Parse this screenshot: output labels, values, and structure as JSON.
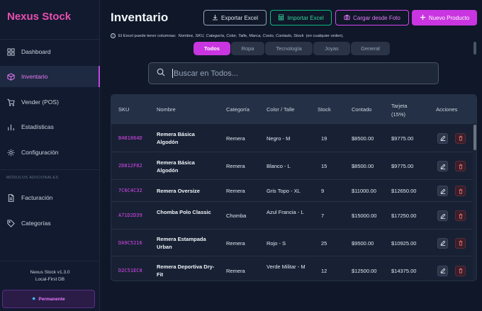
{
  "app": {
    "brand": "Nexus Stock",
    "version": "Nexus Stock v1.3.0",
    "db": "Local-First DB",
    "license": "Permanente"
  },
  "sidebar": {
    "items": [
      {
        "label": "Dashboard",
        "icon": "grid-icon"
      },
      {
        "label": "Inventario",
        "icon": "box-icon"
      },
      {
        "label": "Vender (POS)",
        "icon": "cart-icon"
      },
      {
        "label": "Estadísticas",
        "icon": "bar-chart-icon"
      },
      {
        "label": "Configuración",
        "icon": "gear-icon"
      }
    ],
    "section_label": "MÓDULOS ADICIONALES",
    "extra_items": [
      {
        "label": "Facturación",
        "icon": "document-icon"
      },
      {
        "label": "Categorías",
        "icon": "tag-icon"
      }
    ]
  },
  "header": {
    "title": "Inventario",
    "buttons": {
      "export": "Exportar Excel",
      "import": "Importar Excel",
      "photo": "Cargar desde Foto",
      "new": "Nuevo Producto"
    },
    "hint_prefix": "El Excel puede tener columnas:",
    "hint_columns": "Nombre, SKU, Categoría, Color, Talle, Marca, Costo, Contado, Stock",
    "hint_suffix": "(en cualquier orden)."
  },
  "tabs": [
    "Todos",
    "Ropa",
    "Tecnología",
    "Joyas",
    "General"
  ],
  "active_tab": "Todos",
  "search": {
    "placeholder": "Buscar en Todos...",
    "value": ""
  },
  "table": {
    "headers": [
      "SKU",
      "Nombre",
      "Categoría",
      "Color / Talle",
      "Stock",
      "Contado",
      "Tarjeta\n(15%)",
      "Acciones"
    ],
    "rows": [
      {
        "sku": "B481864D",
        "name": "Remera Básica Algodón",
        "category": "Remera",
        "color": "Negro - M",
        "stock": "19",
        "cash": "$8500.00",
        "card": "$9775.00"
      },
      {
        "sku": "2D812F82",
        "name": "Remera Básica Algodón",
        "category": "Remera",
        "color": "Blanco - L",
        "stock": "15",
        "cash": "$8500.00",
        "card": "$9775.00"
      },
      {
        "sku": "7C6C4C32",
        "name": "Remera Oversize",
        "category": "Remera",
        "color": "Gris Topo - XL",
        "stock": "9",
        "cash": "$11000.00",
        "card": "$12650.00"
      },
      {
        "sku": "A71D2D39",
        "name": "Chomba Polo Classic",
        "category": "Chomba",
        "color": "Azul Francia - L",
        "stock": "7",
        "cash": "$15000.00",
        "card": "$17250.00"
      },
      {
        "sku": "DA9C5216",
        "name": "Remera Estampada Urban",
        "category": "Remera",
        "color": "Rojo - S",
        "stock": "25",
        "cash": "$9500.00",
        "card": "$10925.00"
      },
      {
        "sku": "D2C51EC8",
        "name": "Remera Deportiva Dry-Fit",
        "category": "Remera",
        "color": "Verde Militar - M",
        "stock": "12",
        "cash": "$12500.00",
        "card": "$14375.00"
      }
    ]
  },
  "colors": {
    "accent": "#c935e0",
    "sku": "#d946ef",
    "import": "#10b981",
    "background": "#0f1729"
  }
}
